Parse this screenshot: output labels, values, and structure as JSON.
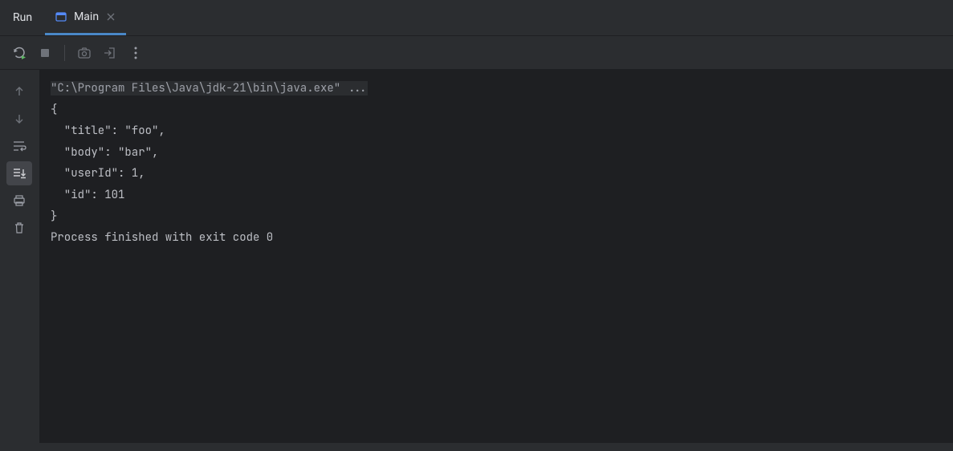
{
  "header": {
    "title": "Run"
  },
  "tab": {
    "label": "Main"
  },
  "console": {
    "command": "\"C:\\Program Files\\Java\\jdk-21\\bin\\java.exe\" ...",
    "line1": "{",
    "line2": "  \"title\": \"foo\",",
    "line3": "  \"body\": \"bar\",",
    "line4": "  \"userId\": 1,",
    "line5": "  \"id\": 101",
    "line6": "}",
    "line7": "",
    "line8": "Process finished with exit code 0"
  }
}
